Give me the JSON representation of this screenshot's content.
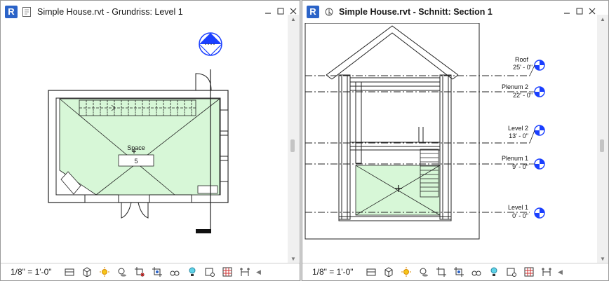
{
  "left_view": {
    "app_badge": "R",
    "view_icon": "floor-plan-icon",
    "title": "Simple House.rvt - Grundriss: Level 1",
    "space_label": "Space",
    "space_number": "5",
    "status": {
      "scale": "1/8\" = 1'-0\""
    }
  },
  "right_view": {
    "app_badge": "R",
    "view_icon": "section-view-icon",
    "title": "Simple House.rvt - Schnitt: Section 1",
    "levels": [
      {
        "name": "Roof",
        "elevation": "25' - 0\""
      },
      {
        "name": "Plenum 2",
        "elevation": "22' - 0\""
      },
      {
        "name": "Level 2",
        "elevation": "13' - 0\""
      },
      {
        "name": "Plenum 1",
        "elevation": "9' - 0\""
      },
      {
        "name": "Level 1",
        "elevation": "0' - 0\""
      }
    ],
    "status": {
      "scale": "1/8\" = 1'-0\""
    }
  },
  "window_controls": [
    "minimize",
    "maximize",
    "close"
  ],
  "colors": {
    "space_fill": "#d7f7d7",
    "level_head": "#1a3fff",
    "revit_blue": "#2b63c8"
  }
}
